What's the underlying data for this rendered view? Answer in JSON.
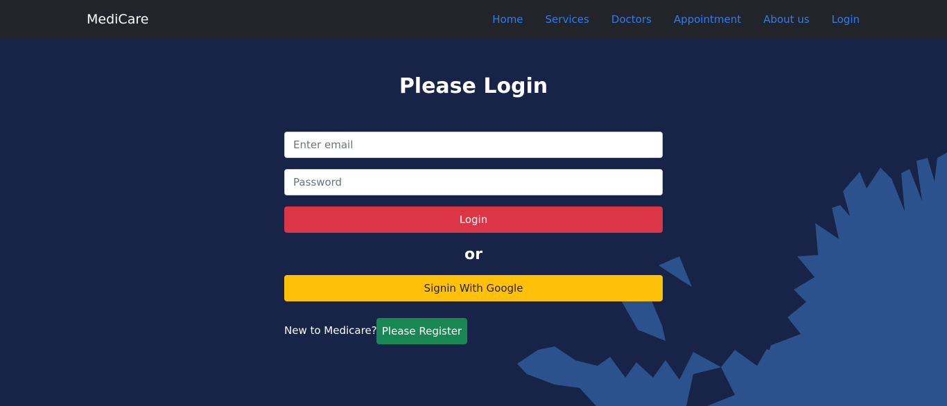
{
  "navbar": {
    "brand": "MediCare",
    "links": [
      "Home",
      "Services",
      "Doctors",
      "Appointment",
      "About us",
      "Login"
    ]
  },
  "login": {
    "title": "Please Login",
    "email_placeholder": "Enter email",
    "password_placeholder": "Password",
    "login_button": "Login",
    "or_text": "or",
    "google_button": "Signin With Google",
    "new_text": "New to Medicare?",
    "register_button": "Please Register"
  },
  "colors": {
    "navbar_bg": "#212529",
    "page_bg": "#172448",
    "decor_shape": "#2c528d",
    "nav_link": "#2f7cf6",
    "login_button": "#dc3545",
    "google_button": "#ffc107",
    "register_button": "#198754"
  }
}
